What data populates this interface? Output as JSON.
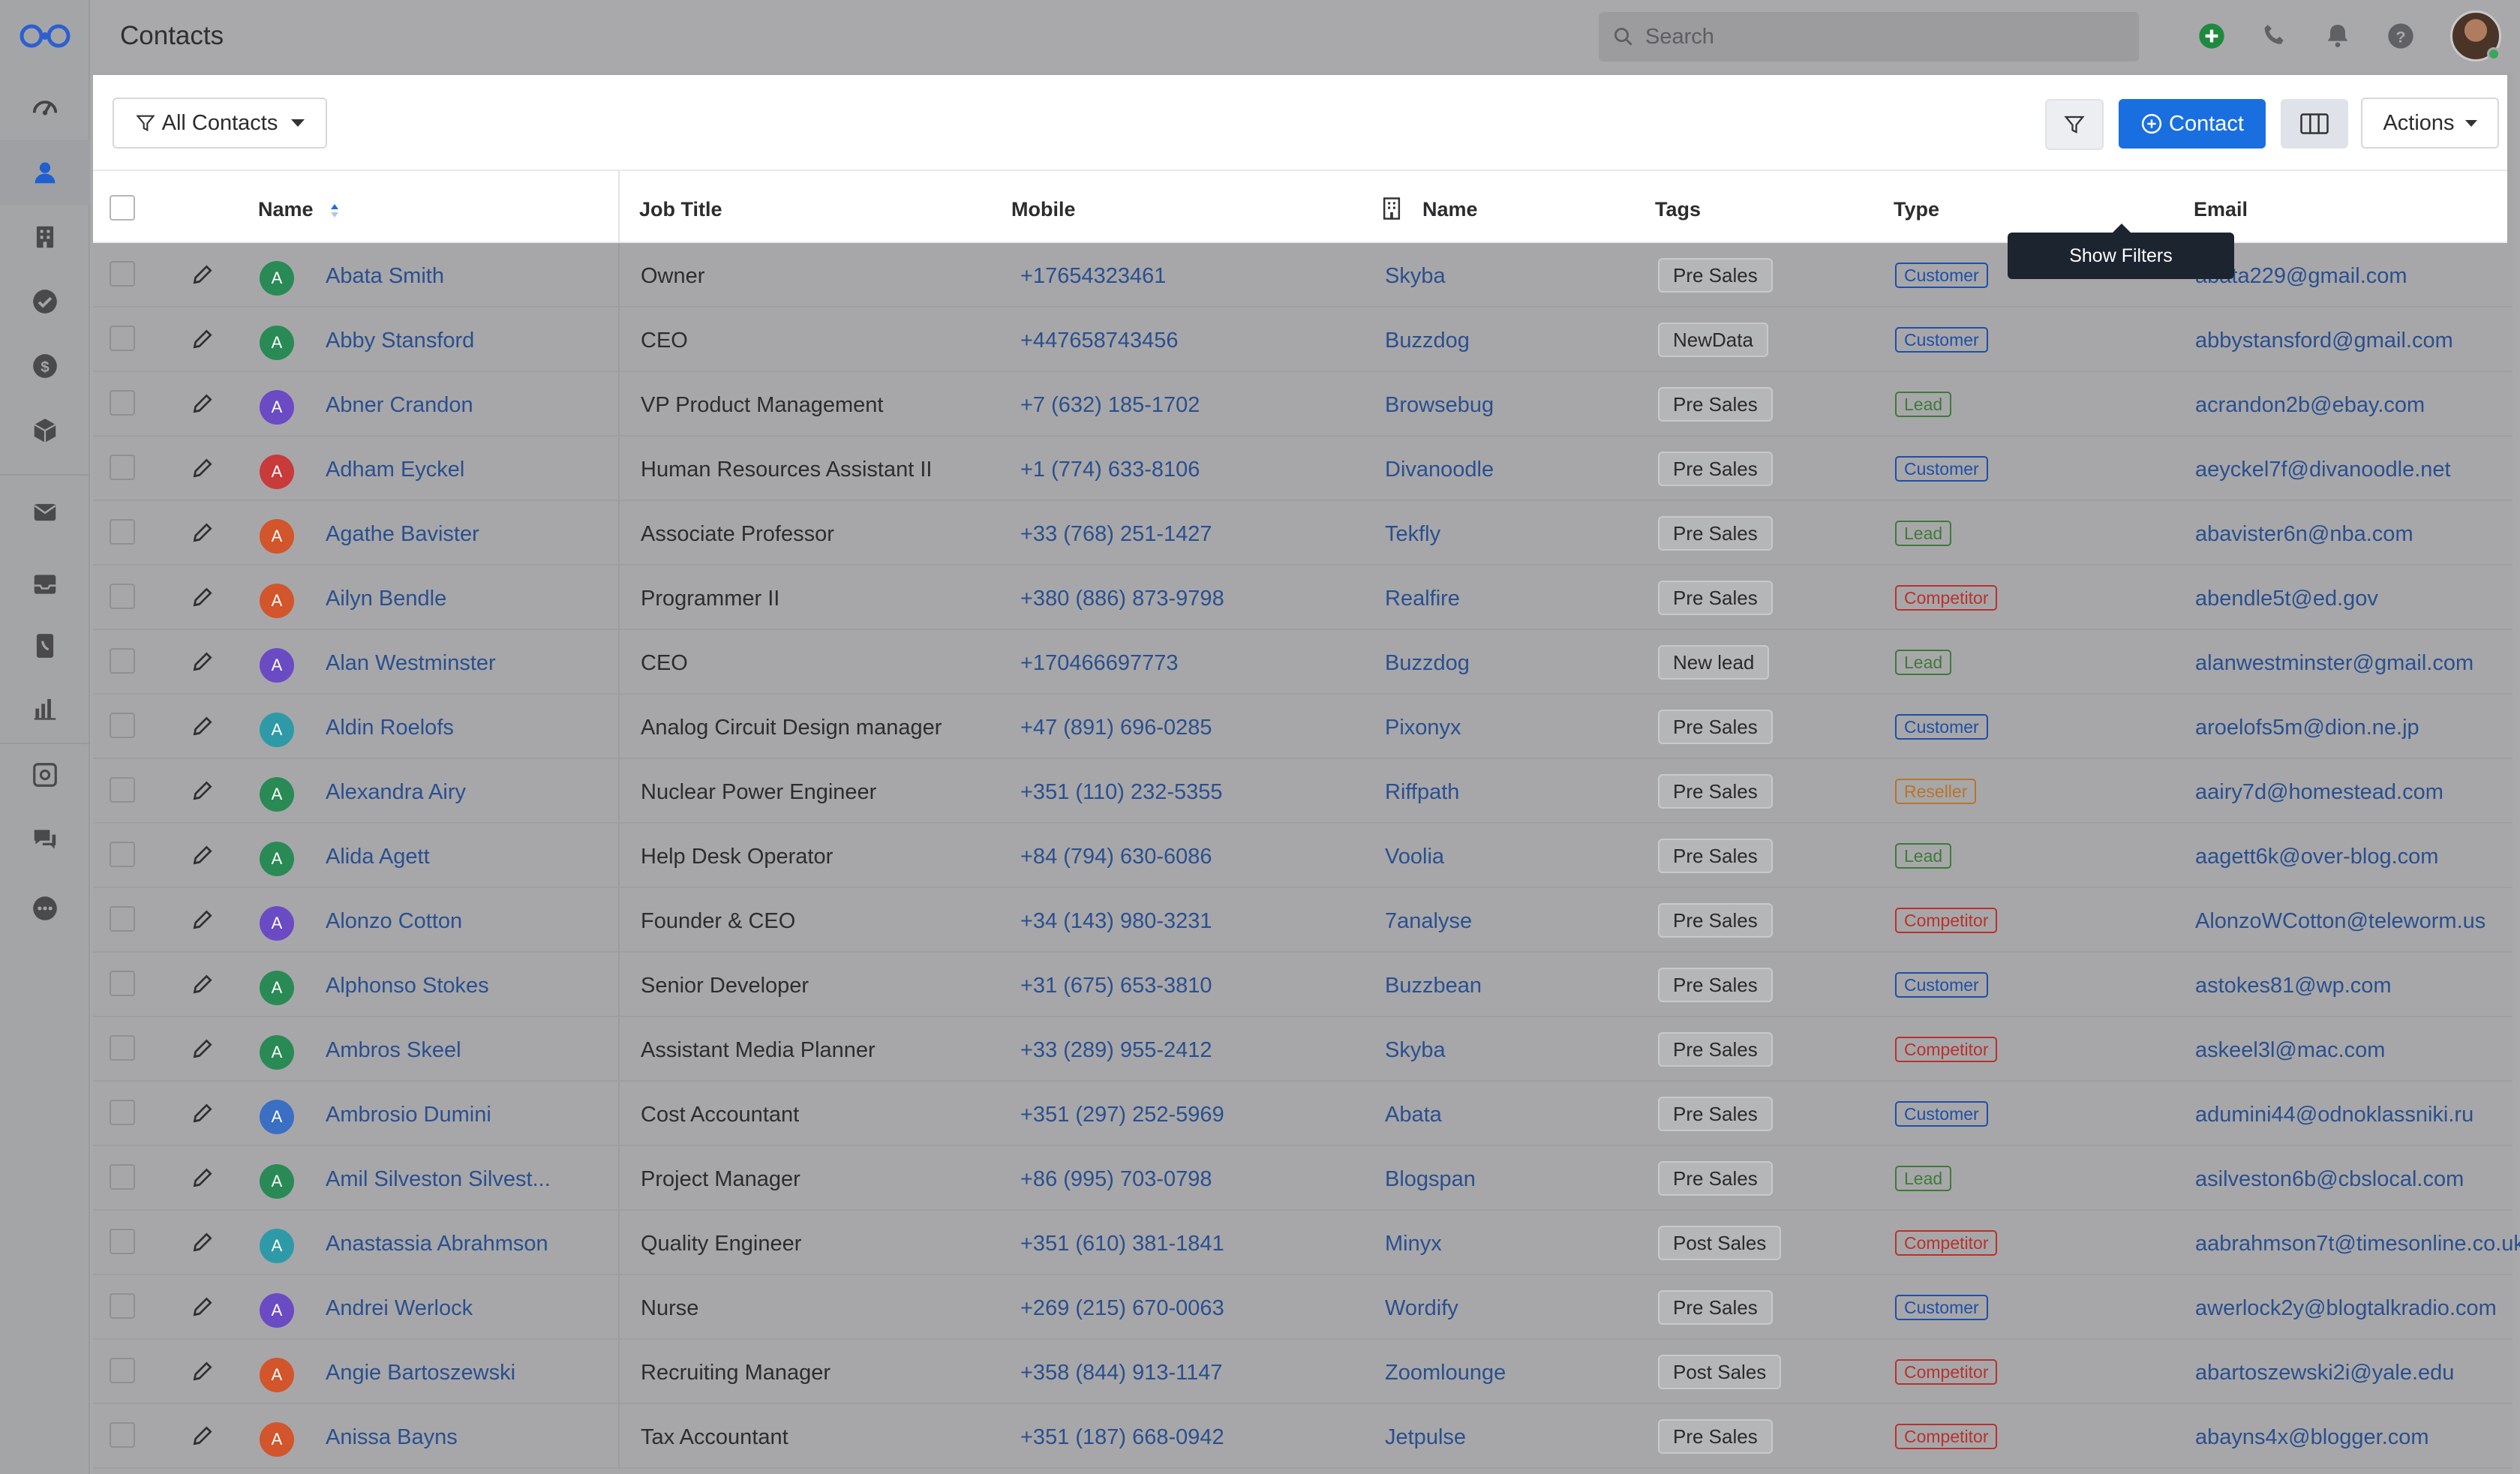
{
  "app": {
    "page_title": "Contacts"
  },
  "search": {
    "placeholder": "Search"
  },
  "toolbar": {
    "view_label": "All Contacts",
    "contact_label": "Contact",
    "actions_label": "Actions",
    "tooltip": "Show Filters"
  },
  "columns": {
    "name": "Name",
    "job_title": "Job Title",
    "mobile": "Mobile",
    "company_name": "Name",
    "tags": "Tags",
    "type": "Type",
    "email": "Email"
  },
  "colors": {
    "primary": "#1a6fe0",
    "avatar_green": "#2a8a55",
    "avatar_purple": "#6a4bc4",
    "avatar_red": "#c93a3a",
    "avatar_orange": "#d2552b",
    "avatar_teal": "#2e9aa8",
    "avatar_blue": "#3a6fc4"
  },
  "rows": [
    {
      "initial": "A",
      "avatar": "green",
      "name": "Abata Smith",
      "job": "Owner",
      "mobile": "+17654323461",
      "company": "Skyba",
      "tag": "Pre Sales",
      "type": "Customer",
      "email": "abata229@gmail.com"
    },
    {
      "initial": "A",
      "avatar": "green",
      "name": "Abby Stansford",
      "job": "CEO",
      "mobile": "+447658743456",
      "company": "Buzzdog",
      "tag": "NewData",
      "type": "Customer",
      "email": "abbystansford@gmail.com"
    },
    {
      "initial": "A",
      "avatar": "purple",
      "name": "Abner Crandon",
      "job": "VP Product Management",
      "mobile": "+7 (632) 185-1702",
      "company": "Browsebug",
      "tag": "Pre Sales",
      "type": "Lead",
      "email": "acrandon2b@ebay.com"
    },
    {
      "initial": "A",
      "avatar": "red",
      "name": "Adham Eyckel",
      "job": "Human Resources Assistant II",
      "mobile": "+1 (774) 633-8106",
      "company": "Divanoodle",
      "tag": "Pre Sales",
      "type": "Customer",
      "email": "aeyckel7f@divanoodle.net"
    },
    {
      "initial": "A",
      "avatar": "orange",
      "name": "Agathe Bavister",
      "job": "Associate Professor",
      "mobile": "+33 (768) 251-1427",
      "company": "Tekfly",
      "tag": "Pre Sales",
      "type": "Lead",
      "email": "abavister6n@nba.com"
    },
    {
      "initial": "A",
      "avatar": "orange",
      "name": "Ailyn Bendle",
      "job": "Programmer II",
      "mobile": "+380 (886) 873-9798",
      "company": "Realfire",
      "tag": "Pre Sales",
      "type": "Competitor",
      "email": "abendle5t@ed.gov"
    },
    {
      "initial": "A",
      "avatar": "purple",
      "name": "Alan Westminster",
      "job": "CEO",
      "mobile": "+170466697773",
      "company": "Buzzdog",
      "tag": "New lead",
      "type": "Lead",
      "email": "alanwestminster@gmail.com"
    },
    {
      "initial": "A",
      "avatar": "teal",
      "name": "Aldin Roelofs",
      "job": "Analog Circuit Design manager",
      "mobile": "+47 (891) 696-0285",
      "company": "Pixonyx",
      "tag": "Pre Sales",
      "type": "Customer",
      "email": "aroelofs5m@dion.ne.jp"
    },
    {
      "initial": "A",
      "avatar": "green",
      "name": "Alexandra Airy",
      "job": "Nuclear Power Engineer",
      "mobile": "+351 (110) 232-5355",
      "company": "Riffpath",
      "tag": "Pre Sales",
      "type": "Reseller",
      "email": "aairy7d@homestead.com"
    },
    {
      "initial": "A",
      "avatar": "green",
      "name": "Alida Agett",
      "job": "Help Desk Operator",
      "mobile": "+84 (794) 630-6086",
      "company": "Voolia",
      "tag": "Pre Sales",
      "type": "Lead",
      "email": "aagett6k@over-blog.com"
    },
    {
      "initial": "A",
      "avatar": "purple",
      "name": "Alonzo Cotton",
      "job": "Founder & CEO",
      "mobile": "+34 (143) 980-3231",
      "company": "7analyse",
      "tag": "Pre Sales",
      "type": "Competitor",
      "email": "AlonzoWCotton@teleworm.us"
    },
    {
      "initial": "A",
      "avatar": "green",
      "name": "Alphonso Stokes",
      "job": "Senior Developer",
      "mobile": "+31 (675) 653-3810",
      "company": "Buzzbean",
      "tag": "Pre Sales",
      "type": "Customer",
      "email": "astokes81@wp.com"
    },
    {
      "initial": "A",
      "avatar": "green",
      "name": "Ambros Skeel",
      "job": "Assistant Media Planner",
      "mobile": "+33 (289) 955-2412",
      "company": "Skyba",
      "tag": "Pre Sales",
      "type": "Competitor",
      "email": "askeel3l@mac.com"
    },
    {
      "initial": "A",
      "avatar": "blue",
      "name": "Ambrosio Dumini",
      "job": "Cost Accountant",
      "mobile": "+351 (297) 252-5969",
      "company": "Abata",
      "tag": "Pre Sales",
      "type": "Customer",
      "email": "adumini44@odnoklassniki.ru"
    },
    {
      "initial": "A",
      "avatar": "green",
      "name": "Amil Silveston Silvest...",
      "job": "Project Manager",
      "mobile": "+86 (995) 703-0798",
      "company": "Blogspan",
      "tag": "Pre Sales",
      "type": "Lead",
      "email": "asilveston6b@cbslocal.com"
    },
    {
      "initial": "A",
      "avatar": "teal",
      "name": "Anastassia Abrahmson",
      "job": "Quality Engineer",
      "mobile": "+351 (610) 381-1841",
      "company": "Minyx",
      "tag": "Post Sales",
      "type": "Competitor",
      "email": "aabrahmson7t@timesonline.co.uk"
    },
    {
      "initial": "A",
      "avatar": "purple",
      "name": "Andrei Werlock",
      "job": "Nurse",
      "mobile": "+269 (215) 670-0063",
      "company": "Wordify",
      "tag": "Pre Sales",
      "type": "Customer",
      "email": "awerlock2y@blogtalkradio.com"
    },
    {
      "initial": "A",
      "avatar": "orange",
      "name": "Angie Bartoszewski",
      "job": "Recruiting Manager",
      "mobile": "+358 (844) 913-1147",
      "company": "Zoomlounge",
      "tag": "Post Sales",
      "type": "Competitor",
      "email": "abartoszewski2i@yale.edu"
    },
    {
      "initial": "A",
      "avatar": "orange",
      "name": "Anissa Bayns",
      "job": "Tax Accountant",
      "mobile": "+351 (187) 668-0942",
      "company": "Jetpulse",
      "tag": "Pre Sales",
      "type": "Competitor",
      "email": "abayns4x@blogger.com"
    }
  ]
}
